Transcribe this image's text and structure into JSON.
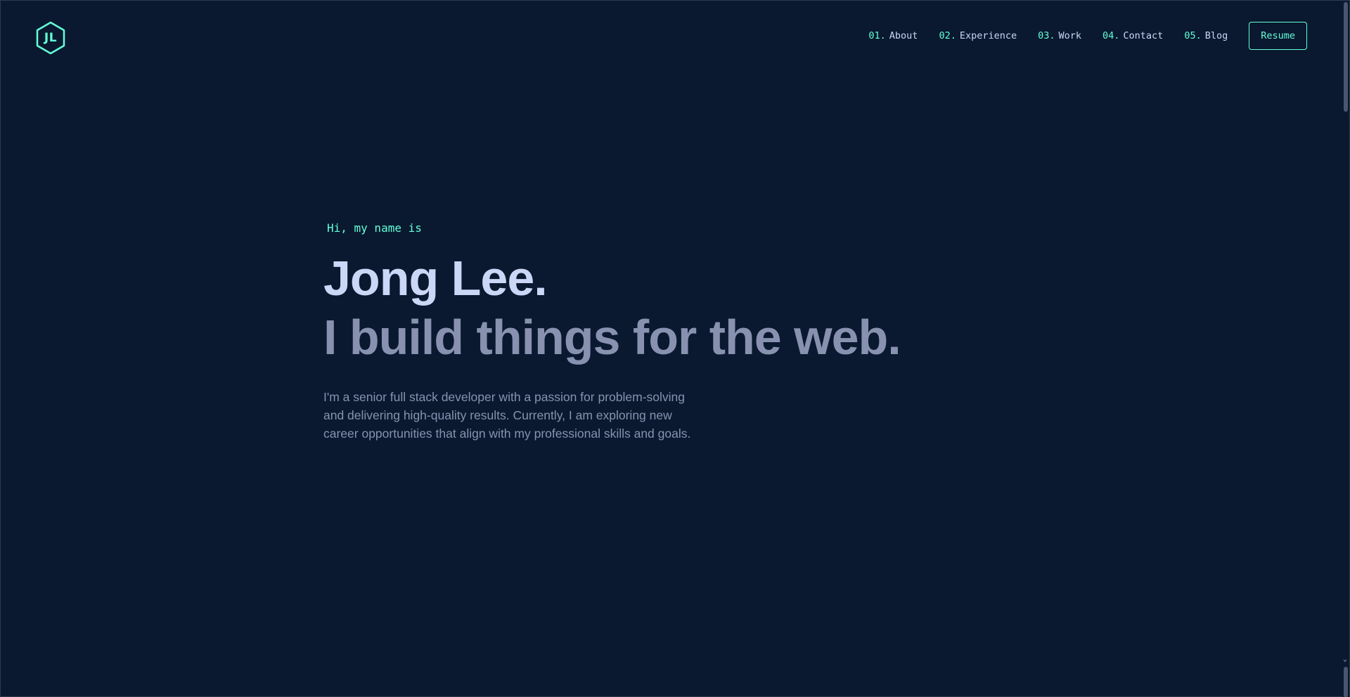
{
  "logo": {
    "initials": "JL",
    "icon": "hexagon-logo-icon",
    "color": "#64ffda"
  },
  "nav": {
    "items": [
      {
        "num": "01.",
        "label": "About"
      },
      {
        "num": "02.",
        "label": "Experience"
      },
      {
        "num": "03.",
        "label": "Work"
      },
      {
        "num": "04.",
        "label": "Contact"
      },
      {
        "num": "05.",
        "label": "Blog"
      }
    ],
    "resume_label": "Resume"
  },
  "hero": {
    "greeting": "Hi, my name is",
    "name": "Jong Lee.",
    "tagline": "I build things for the web.",
    "intro": "I'm a senior full stack developer with a passion for problem-solving and delivering high-quality results. Currently, I am exploring new career opportunities that align with my professional skills and goals."
  },
  "colors": {
    "background": "#0a192f",
    "accent": "#64ffda",
    "heading": "#ccd6f6",
    "muted": "#8892b0"
  }
}
